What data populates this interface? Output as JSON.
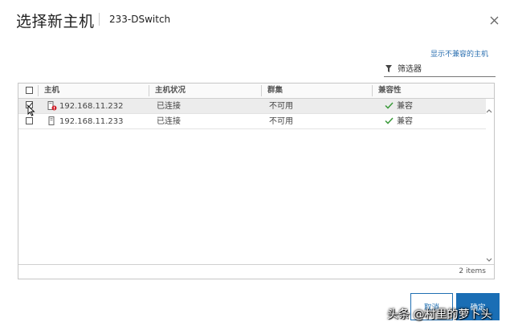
{
  "dialog": {
    "title": "选择新主机",
    "subtitle": "233-DSwitch",
    "close_icon": "close-icon"
  },
  "incompatible_link": "显示不兼容的主机",
  "filter": {
    "placeholder": "筛选器",
    "icon": "filter-icon"
  },
  "grid": {
    "columns": [
      "主机",
      "主机状况",
      "群集",
      "兼容性"
    ],
    "rows": [
      {
        "checked": true,
        "host": "192.168.11.232",
        "status": "已连接",
        "cluster": "不可用",
        "compat": "兼容",
        "host_icon": "host-alert-icon"
      },
      {
        "checked": false,
        "host": "192.168.11.233",
        "status": "已连接",
        "cluster": "不可用",
        "compat": "兼容",
        "host_icon": "host-icon"
      }
    ],
    "item_count": "2 items"
  },
  "buttons": {
    "cancel": "取消",
    "ok": "确定"
  },
  "watermark": "头条 @村里的萝卜头",
  "colors": {
    "accent": "#1a6eb5",
    "link": "#2a6fb0",
    "check_green": "#3a9a3a",
    "alert_red": "#d0202a"
  }
}
